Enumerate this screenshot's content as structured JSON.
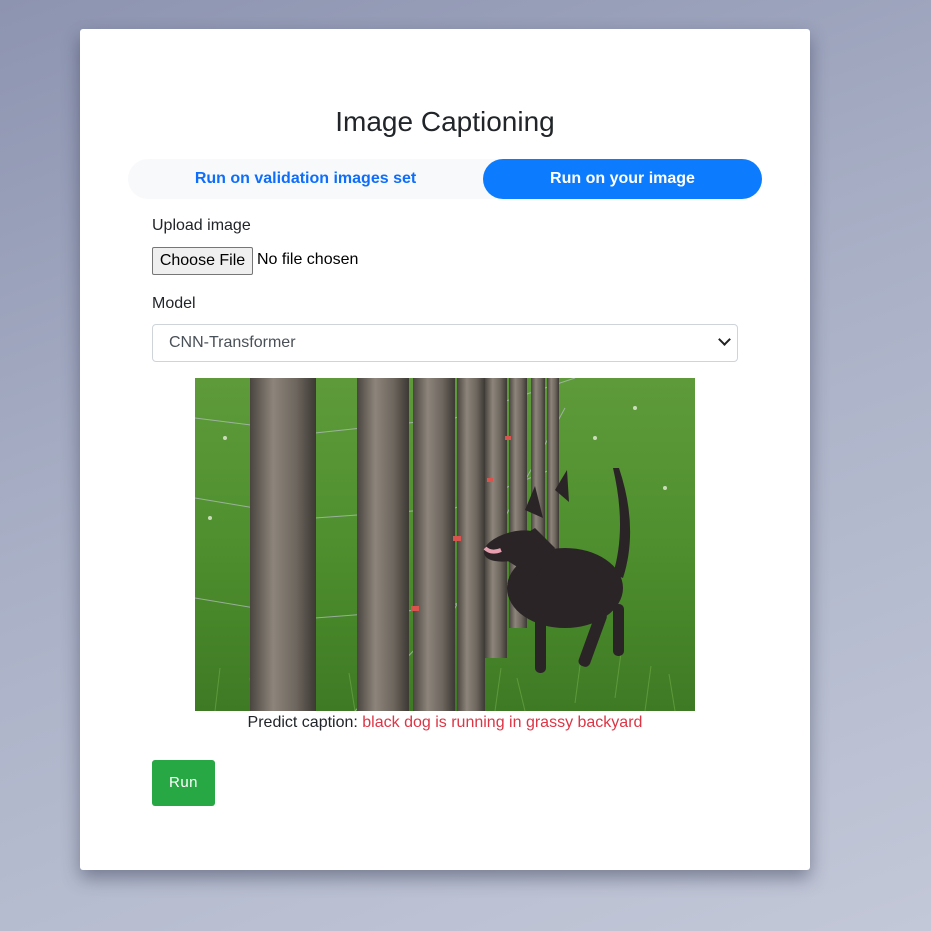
{
  "page": {
    "title": "Image Captioning"
  },
  "tabs": [
    {
      "label": "Run on validation images set",
      "active": false
    },
    {
      "label": "Run on your image",
      "active": true
    }
  ],
  "upload": {
    "label": "Upload image",
    "button_label": "Choose File",
    "status": "No file chosen"
  },
  "model": {
    "label": "Model",
    "selected": "CNN-Transformer"
  },
  "result": {
    "prefix": "Predict caption:",
    "caption": "black dog is running in grassy backyard",
    "image_description_icon": "photo-dog-fence"
  },
  "actions": {
    "run_label": "Run"
  },
  "colors": {
    "primary": "#0d7bfd",
    "success": "#28a745",
    "danger": "#dc3545",
    "tab_bg": "#f8f9fa"
  }
}
